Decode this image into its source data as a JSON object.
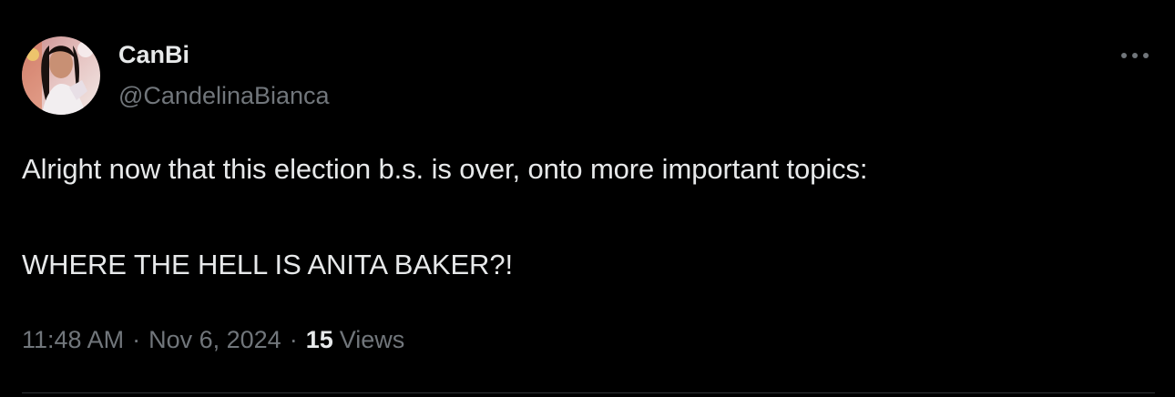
{
  "tweet": {
    "display_name": "CanBi",
    "handle": "@CandelinaBianca",
    "text_line_1": "Alright now that this election b.s. is over, onto more important topics:",
    "text_line_2": "WHERE THE HELL IS ANITA BAKER?!",
    "time": "11:48 AM",
    "separator": "·",
    "date": "Nov 6, 2024",
    "views_count": "15",
    "views_label": "Views",
    "more_icon": "more-horizontal-icon",
    "avatar_icon": "avatar"
  },
  "colors": {
    "background": "#000000",
    "primary_text": "#e7e9ea",
    "secondary_text": "#71767b",
    "divider": "#2f3336"
  }
}
